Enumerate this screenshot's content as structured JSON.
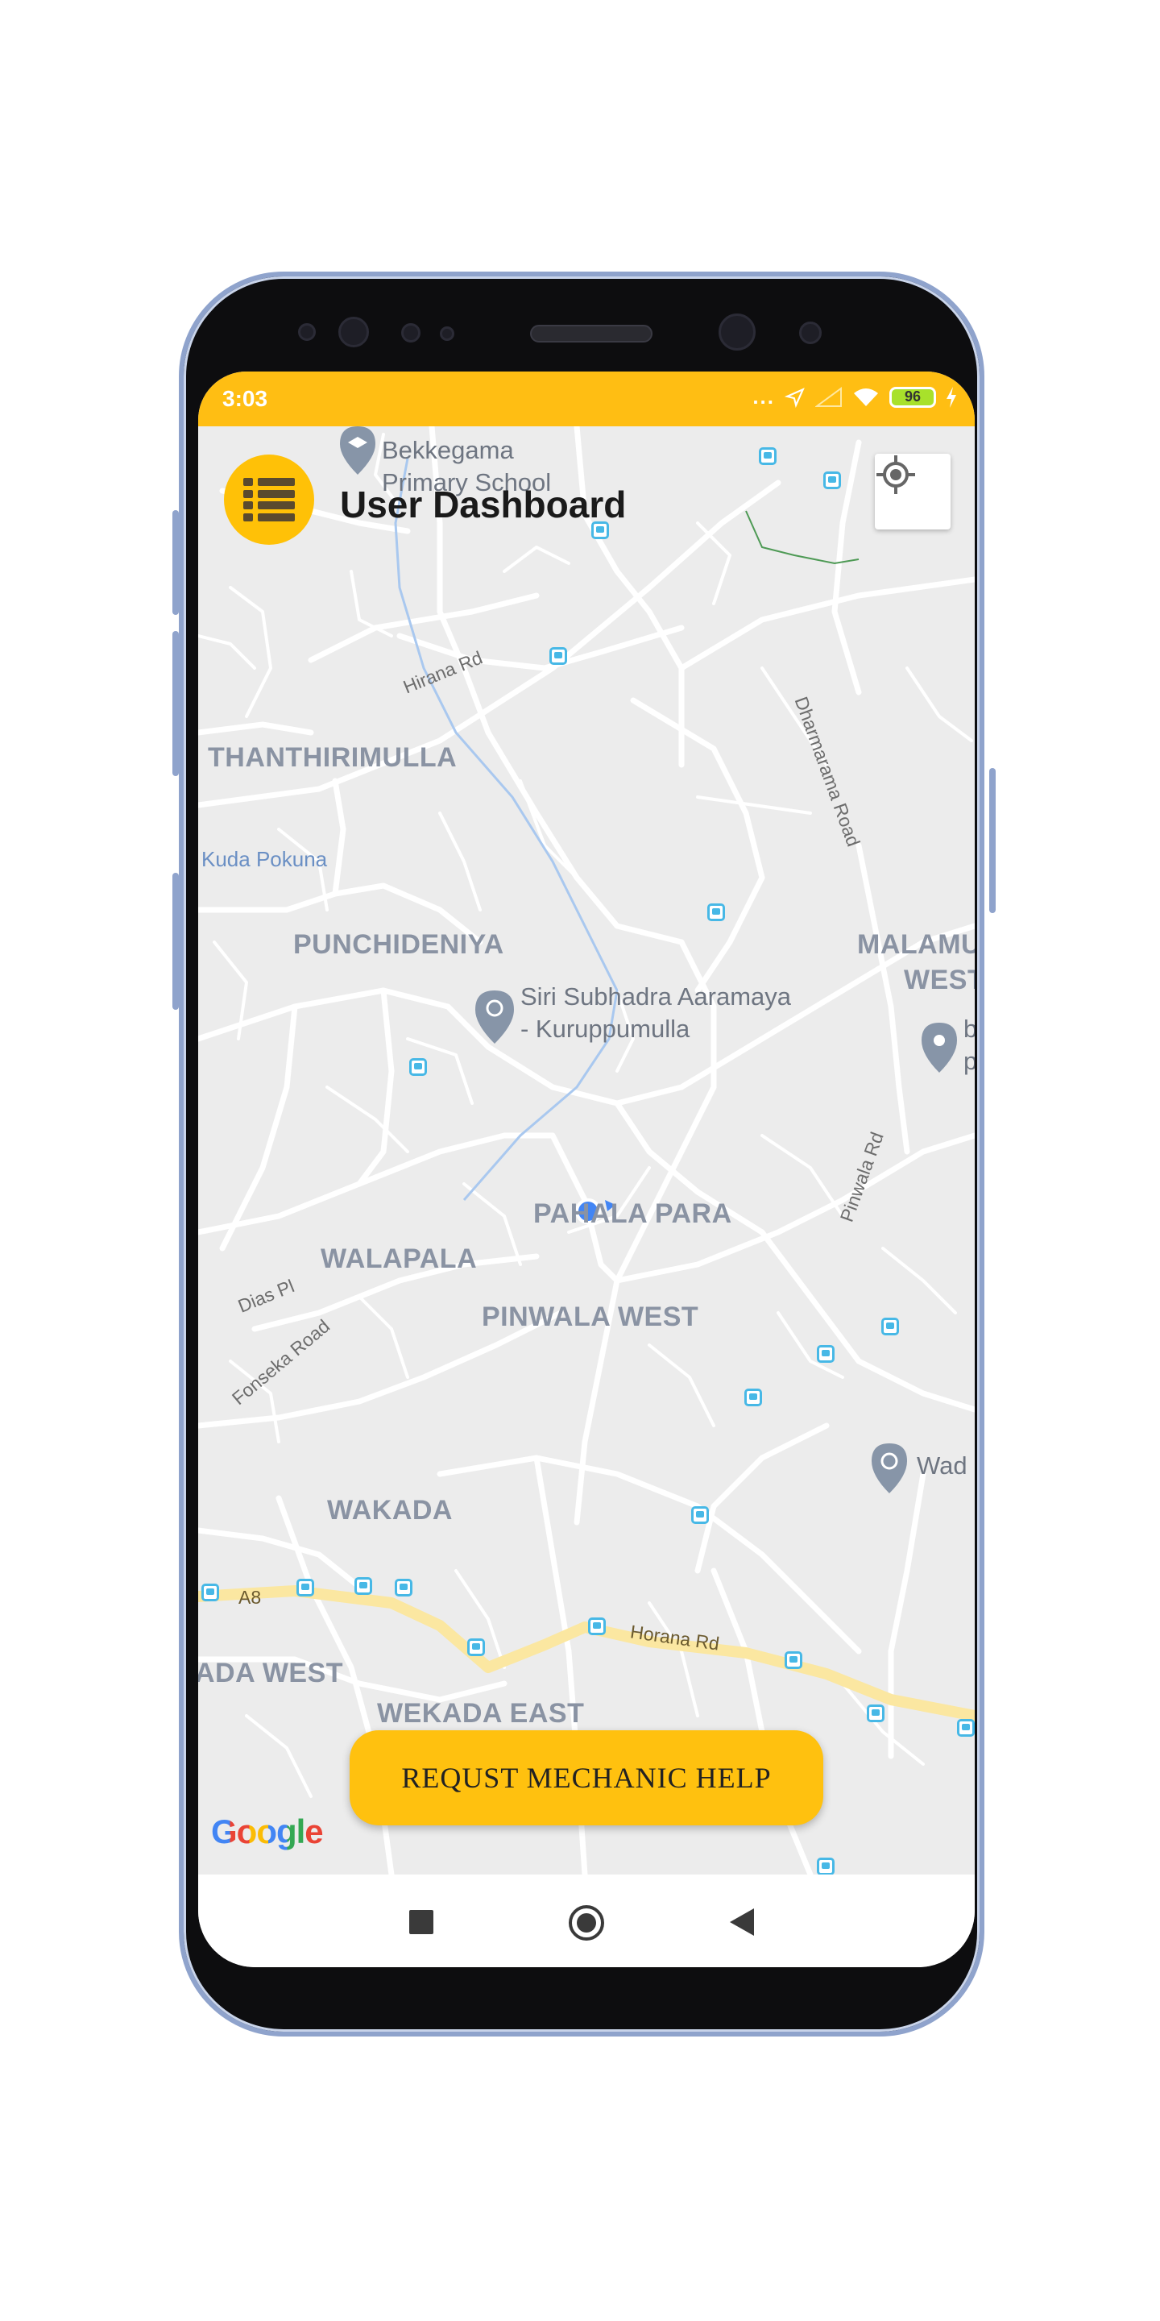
{
  "status_bar": {
    "time": "3:03",
    "dots": "...",
    "battery": "96"
  },
  "header": {
    "title": "User Dashboard",
    "menu_icon": "menu-list-icon",
    "locate_icon": "my-location-icon"
  },
  "map": {
    "places": {
      "thanthirimulla": "THANTHIRIMULLA",
      "punchideniya": "PUNCHIDENIYA",
      "malamu": "MALAMU",
      "west": "WEST",
      "pahala_para": "PAHALA PARA",
      "walapala": "WALAPALA",
      "pinwala_west": "PINWALA WEST",
      "wakada": "WAKADA",
      "ada_west": "ADA WEST",
      "wekada_east": "WEKADA EAST"
    },
    "roads": {
      "hirana_rd": "Hirana Rd",
      "dharmarama_road": "Dharmarama Road",
      "pinwala_rd": "Pinwala Rd",
      "dias_pl": "Dias Pl",
      "fonseka_road": "Fonseka Road",
      "horana_rd": "Horana Rd",
      "a8": "A8"
    },
    "water": {
      "kuda_pokuna": "Kuda Pokuna"
    },
    "pois": {
      "school_line1": "Bekkegama",
      "school_line2": "Primary School",
      "temple_line1": "Siri Subhadra Aaramaya",
      "temple_line2": "- Kuruppumulla",
      "wad": "Wad",
      "b": "b",
      "p": "p"
    },
    "attribution": "Google"
  },
  "action_button": {
    "label": "REQUST MECHANIC HELP"
  },
  "colors": {
    "accent": "#ffbe13",
    "map_bg": "#ececec",
    "place_text": "#8a93a3",
    "bus_stop": "#47b8e6",
    "highway": "#fbe7a1"
  }
}
